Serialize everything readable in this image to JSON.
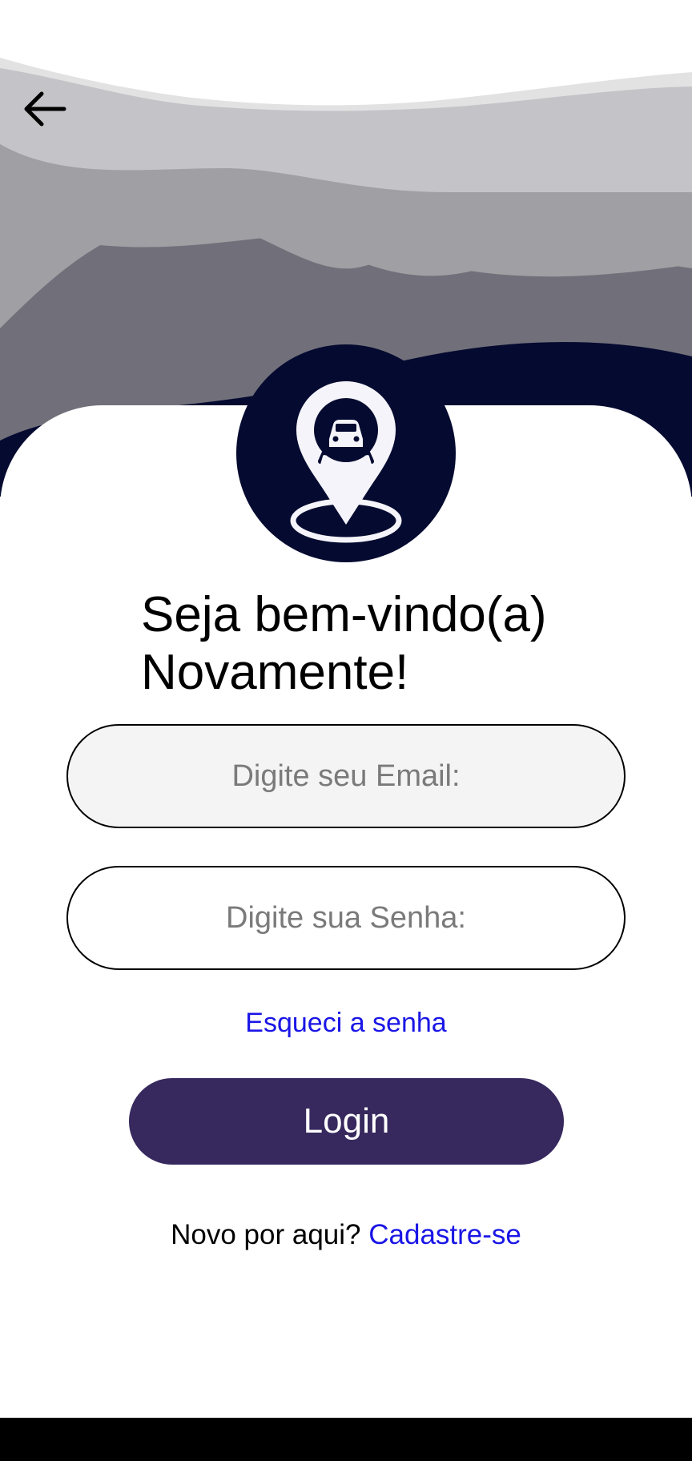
{
  "header": {
    "back_icon": "arrow-left-icon"
  },
  "logo": {
    "icon": "map-pin-car-icon"
  },
  "welcome": {
    "line1": "Seja bem-vindo(a)",
    "line2": "Novamente!"
  },
  "form": {
    "email_placeholder": "Digite seu Email:",
    "email_value": "",
    "password_placeholder": "Digite sua Senha:",
    "password_value": "",
    "forgot_label": "Esqueci a senha",
    "login_label": "Login"
  },
  "signup": {
    "prompt": "Novo por aqui?",
    "link_label": "Cadastre-se"
  },
  "colors": {
    "primary_button": "#37295e",
    "link": "#1a16e6",
    "logo_background": "#050a30",
    "wave_dark": "#050a30"
  }
}
